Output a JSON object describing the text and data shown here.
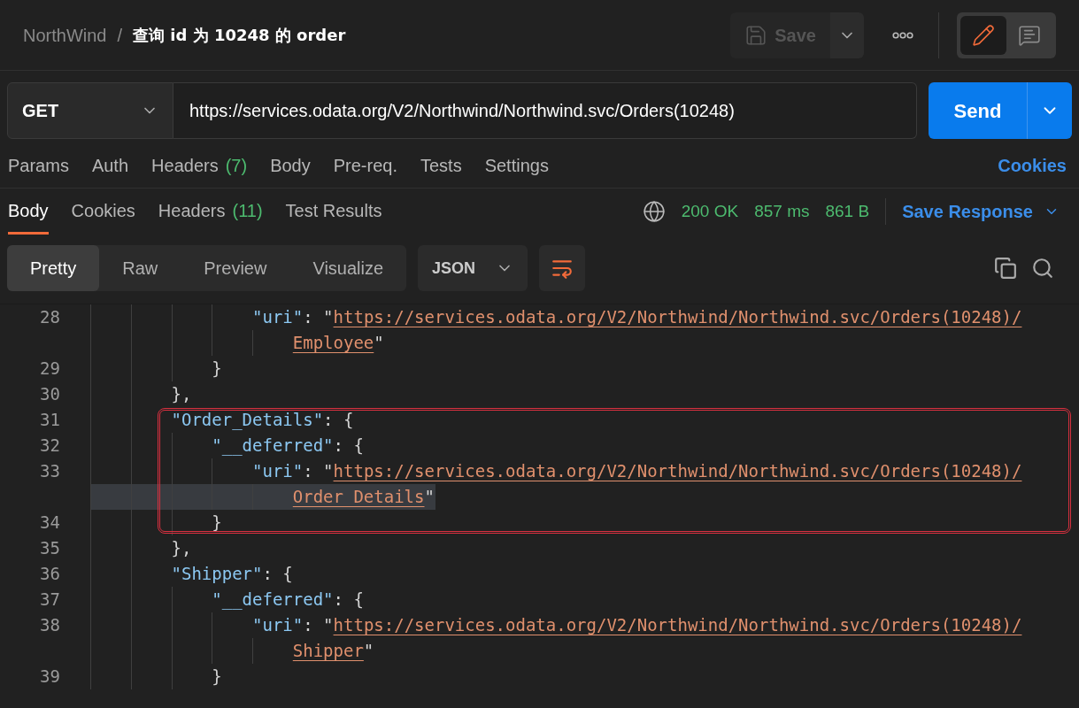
{
  "header": {
    "breadcrumb": [
      "NorthWind",
      "查询 id 为 10248 的 order"
    ],
    "separator": "/",
    "save": "Save",
    "modes": [
      {
        "kind": "edit",
        "selected": true
      },
      {
        "kind": "comment",
        "selected": false
      }
    ]
  },
  "request": {
    "method": "GET",
    "url": "https://services.odata.org/V2/Northwind/Northwind.svc/Orders(10248)",
    "send": "Send"
  },
  "request_tabs": [
    {
      "label": "Params"
    },
    {
      "label": "Auth"
    },
    {
      "label": "Headers",
      "count": "(7)"
    },
    {
      "label": "Body"
    },
    {
      "label": "Pre-req."
    },
    {
      "label": "Tests"
    },
    {
      "label": "Settings"
    }
  ],
  "cookies_link": "Cookies",
  "response_tabs": [
    {
      "label": "Body",
      "selected": true
    },
    {
      "label": "Cookies",
      "selected": false
    },
    {
      "label": "Headers",
      "count": "(11)",
      "selected": false
    },
    {
      "label": "Test Results",
      "selected": false
    }
  ],
  "status": {
    "code": "200 OK",
    "time": "857 ms",
    "size": "861 B",
    "save_response": "Save Response"
  },
  "view_tabs": [
    {
      "label": "Pretty",
      "selected": true
    },
    {
      "label": "Raw",
      "selected": false
    },
    {
      "label": "Preview",
      "selected": false
    },
    {
      "label": "Visualize",
      "selected": false
    }
  ],
  "format": "JSON",
  "code_rows": [
    {
      "number": "28",
      "boxed": false,
      "highlighted": false,
      "segments": [
        {
          "kind": "key",
          "text": "                \"uri\""
        },
        {
          "kind": "punct",
          "text": ": \""
        },
        {
          "kind": "link",
          "text": "https://services.odata.org/V2/Northwind/Northwind.svc/Orders(10248)/"
        }
      ]
    },
    {
      "boxed": false,
      "highlighted": false,
      "segments": [
        {
          "kind": "link",
          "text": "                    Employee"
        },
        {
          "kind": "punct",
          "text": "\""
        }
      ]
    },
    {
      "number": "29",
      "boxed": false,
      "highlighted": false,
      "segments": [
        {
          "kind": "punct",
          "text": "            }"
        }
      ]
    },
    {
      "number": "30",
      "boxed": false,
      "highlighted": false,
      "segments": [
        {
          "kind": "punct",
          "text": "        },"
        }
      ]
    },
    {
      "number": "31",
      "boxed": true,
      "highlighted": false,
      "segments": [
        {
          "kind": "key",
          "text": "        \"Order_Details\""
        },
        {
          "kind": "punct",
          "text": ": {"
        }
      ]
    },
    {
      "number": "32",
      "boxed": true,
      "highlighted": false,
      "segments": [
        {
          "kind": "key",
          "text": "            \"__deferred\""
        },
        {
          "kind": "punct",
          "text": ": {"
        }
      ]
    },
    {
      "number": "33",
      "boxed": true,
      "highlighted": false,
      "segments": [
        {
          "kind": "key",
          "text": "                \"uri\""
        },
        {
          "kind": "punct",
          "text": ": \""
        },
        {
          "kind": "link",
          "text": "https://services.odata.org/V2/Northwind/Northwind.svc/Orders(10248)/"
        }
      ]
    },
    {
      "boxed": true,
      "highlighted": true,
      "segments": [
        {
          "kind": "link",
          "text": "                    Order_Details"
        },
        {
          "kind": "punct",
          "text": "\""
        }
      ]
    },
    {
      "number": "34",
      "boxed": true,
      "highlighted": false,
      "segments": [
        {
          "kind": "punct",
          "text": "            }"
        }
      ]
    },
    {
      "number": "35",
      "boxed": false,
      "highlighted": false,
      "segments": [
        {
          "kind": "punct",
          "text": "        },"
        }
      ]
    },
    {
      "number": "36",
      "boxed": false,
      "highlighted": false,
      "segments": [
        {
          "kind": "key",
          "text": "        \"Shipper\""
        },
        {
          "kind": "punct",
          "text": ": {"
        }
      ]
    },
    {
      "number": "37",
      "boxed": false,
      "highlighted": false,
      "segments": [
        {
          "kind": "key",
          "text": "            \"__deferred\""
        },
        {
          "kind": "punct",
          "text": ": {"
        }
      ]
    },
    {
      "number": "38",
      "boxed": false,
      "highlighted": false,
      "segments": [
        {
          "kind": "key",
          "text": "                \"uri\""
        },
        {
          "kind": "punct",
          "text": ": \""
        },
        {
          "kind": "link",
          "text": "https://services.odata.org/V2/Northwind/Northwind.svc/Orders(10248)/"
        }
      ]
    },
    {
      "boxed": false,
      "highlighted": false,
      "segments": [
        {
          "kind": "link",
          "text": "                    Shipper"
        },
        {
          "kind": "punct",
          "text": "\""
        }
      ]
    },
    {
      "number": "39",
      "boxed": false,
      "highlighted": false,
      "segments": [
        {
          "kind": "punct",
          "text": "            }"
        }
      ]
    }
  ]
}
